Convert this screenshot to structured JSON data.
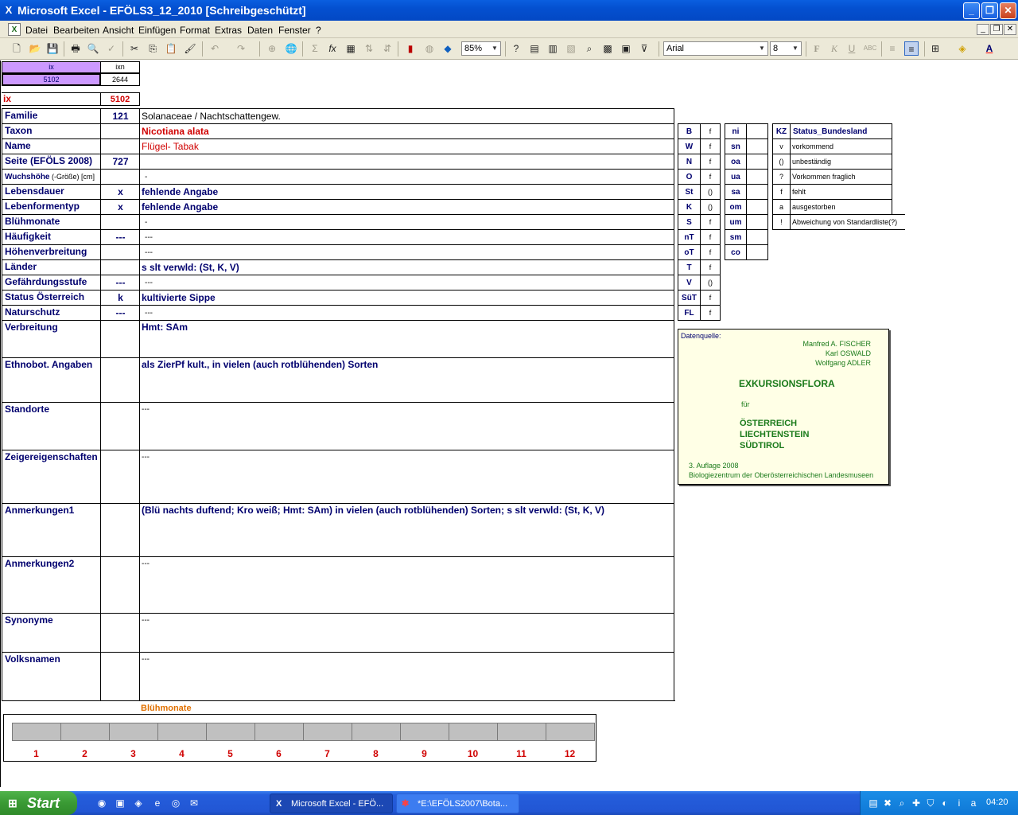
{
  "window": {
    "title": "Microsoft Excel - EFÖLS3_12_2010  [Schreibgeschützt]"
  },
  "menu": [
    "Datei",
    "Bearbeiten",
    "Ansicht",
    "Einfügen",
    "Format",
    "Extras",
    "Daten",
    "Fenster",
    "?"
  ],
  "toolbar": {
    "zoom": "85%",
    "font": "Arial",
    "size": "8"
  },
  "header_cells": {
    "ix_label": "ix",
    "ixn_label": "ixn",
    "ix_value": "5102",
    "ixn_value": "2644",
    "ix2_label": "ix",
    "ix2_value": "5102"
  },
  "rows": [
    {
      "label": "Familie",
      "num": "121",
      "value": "Solanaceae  /  Nachtschattengew."
    },
    {
      "label": "Taxon",
      "num": "",
      "value": "Nicotiana alata"
    },
    {
      "label": "Name",
      "num": "",
      "value": "Flügel- Tabak"
    },
    {
      "label": "Seite (EFÖLS 2008)",
      "num": "727",
      "value": ""
    },
    {
      "label": "Wuchshöhe",
      "label_suffix": " (-Größe) [cm]",
      "num": "",
      "value": "-"
    },
    {
      "label": "Lebensdauer",
      "num": "x",
      "value": "fehlende Angabe"
    },
    {
      "label": "Lebenformentyp",
      "num": "x",
      "value": "fehlende Angabe"
    },
    {
      "label": "Blühmonate",
      "num": "",
      "value": "-"
    },
    {
      "label": "Häufigkeit",
      "num": "---",
      "value": "---"
    },
    {
      "label": "Höhenverbreitung",
      "num": "",
      "value": "---"
    },
    {
      "label": "Länder",
      "num": "",
      "value": "s slt verwld: (St, K, V)"
    },
    {
      "label": "Gefährdungsstufe",
      "num": "---",
      "value": "---"
    },
    {
      "label": "Status Österreich",
      "num": "k",
      "value": "kultivierte Sippe"
    },
    {
      "label": "Naturschutz",
      "num": "---",
      "value": "---"
    },
    {
      "label": "Verbreitung",
      "num": "",
      "value": "Hmt: SAm"
    },
    {
      "label": "Ethnobot. Angaben",
      "num": "",
      "value": "als ZierPf kult., in vielen (auch rotblühenden) Sorten"
    },
    {
      "label": "Standorte",
      "num": "",
      "value": "---"
    },
    {
      "label": "Zeigereigenschaften",
      "num": "",
      "value": "---"
    },
    {
      "label": "Anmerkungen1",
      "num": "",
      "value": "(Blü nachts duftend; Kro weiß; Hmt: SAm) in vielen (auch rotblühenden) Sorten; s slt verwld: (St, K, V)"
    },
    {
      "label": "Anmerkungen2",
      "num": "",
      "value": "---"
    },
    {
      "label": "Synonyme",
      "num": "",
      "value": "---"
    },
    {
      "label": "Volksnamen",
      "num": "",
      "value": "---"
    }
  ],
  "states": [
    {
      "code": "B",
      "v": "f"
    },
    {
      "code": "W",
      "v": "f"
    },
    {
      "code": "N",
      "v": "f"
    },
    {
      "code": "O",
      "v": "f"
    },
    {
      "code": "St",
      "v": "()"
    },
    {
      "code": "K",
      "v": "()"
    },
    {
      "code": "S",
      "v": "f"
    },
    {
      "code": "nT",
      "v": "f"
    },
    {
      "code": "oT",
      "v": "f"
    },
    {
      "code": "T",
      "v": "f"
    },
    {
      "code": "V",
      "v": "()"
    },
    {
      "code": "SüT",
      "v": "f"
    },
    {
      "code": "FL",
      "v": "f"
    }
  ],
  "regions": [
    "ni",
    "sn",
    "oa",
    "ua",
    "sa",
    "om",
    "um",
    "sm",
    "co"
  ],
  "legend": {
    "head_kz": "KZ",
    "head_status": "Status_Bundesland",
    "items": [
      {
        "kz": "v",
        "text": "vorkommend"
      },
      {
        "kz": "()",
        "text": "unbeständig"
      },
      {
        "kz": "?",
        "text": "Vorkommen fraglich"
      },
      {
        "kz": "f",
        "text": "fehlt"
      },
      {
        "kz": "a",
        "text": "ausgestorben"
      },
      {
        "kz": "!",
        "text": "Abweichung von Standardliste(?)"
      }
    ]
  },
  "source": {
    "label": "Datenquelle:",
    "authors": [
      "Manfred A. FISCHER",
      "Karl OSWALD",
      "Wolfgang ADLER"
    ],
    "title": "EXKURSIONSFLORA",
    "for": "für",
    "countries": [
      "ÖSTERREICH",
      "LIECHTENSTEIN",
      "SÜDTIROL"
    ],
    "edition": "3. Auflage 2008",
    "publisher": "Biologiezentrum der Oberösterreichischen Landesmuseen"
  },
  "bloom": {
    "title": "Blühmonate",
    "months": [
      "1",
      "2",
      "3",
      "4",
      "5",
      "6",
      "7",
      "8",
      "9",
      "10",
      "11",
      "12"
    ]
  },
  "taskbar": {
    "start": "Start",
    "tasks": [
      "Microsoft Excel - EFÖ...",
      "*E:\\EFÖLS2007\\Bota..."
    ],
    "clock": "04:20"
  }
}
